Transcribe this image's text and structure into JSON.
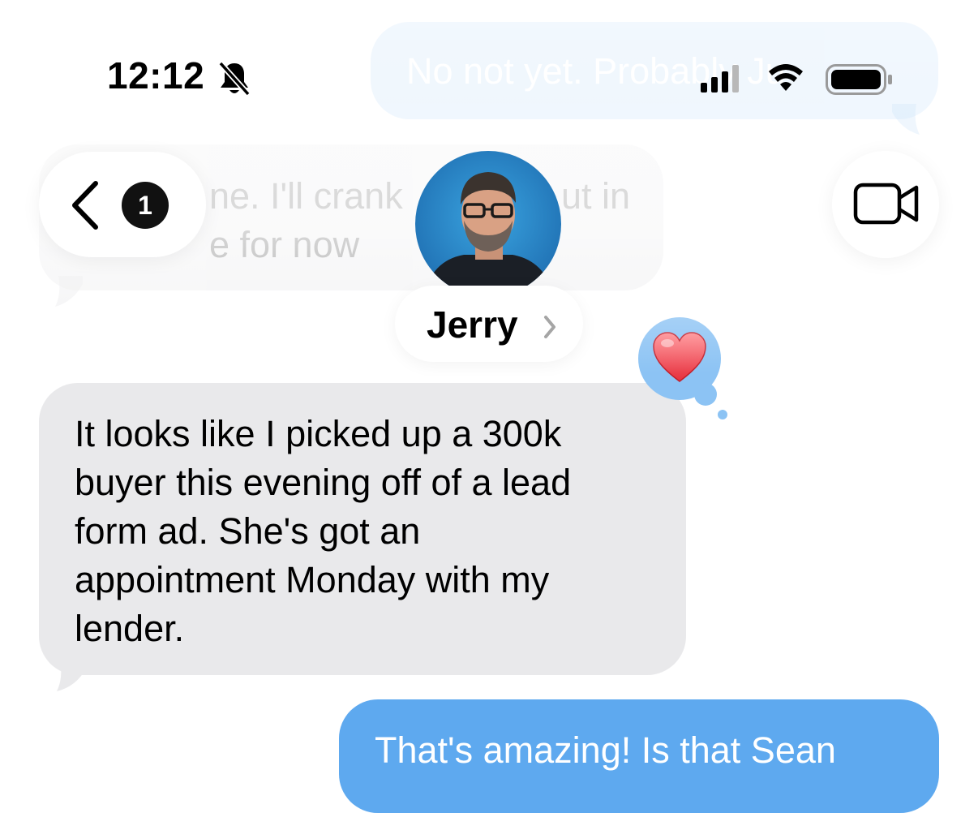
{
  "status_bar": {
    "time": "12:12",
    "icons": [
      "bell-slash-icon",
      "cellular-signal-icon",
      "wifi-icon",
      "battery-icon"
    ]
  },
  "nav": {
    "back_badge_count": "1",
    "contact_name": "Jerry",
    "icons": [
      "chevron-left-icon",
      "video-camera-icon",
      "chevron-right-icon"
    ]
  },
  "messages": [
    {
      "direction": "outgoing",
      "text": "No not yet. Probably Ju",
      "state": "faded-behind-header"
    },
    {
      "direction": "incoming",
      "line1": "ne. I'll crank",
      "line1b": "ut in",
      "line2": "e for now",
      "state": "faded-behind-header"
    },
    {
      "direction": "incoming",
      "reaction": "heart",
      "lines": [
        "It looks like I picked up a 300k",
        "buyer this evening off of a lead",
        "form ad. She's got an",
        "appointment Monday with my",
        "lender."
      ]
    },
    {
      "direction": "outgoing",
      "text": "That's amazing! Is that Sean"
    }
  ],
  "colors": {
    "incoming_bubble": "#e9e9eb",
    "outgoing_bubble": "#5ea9ef",
    "reaction_bubble": "#8cc3f4"
  }
}
